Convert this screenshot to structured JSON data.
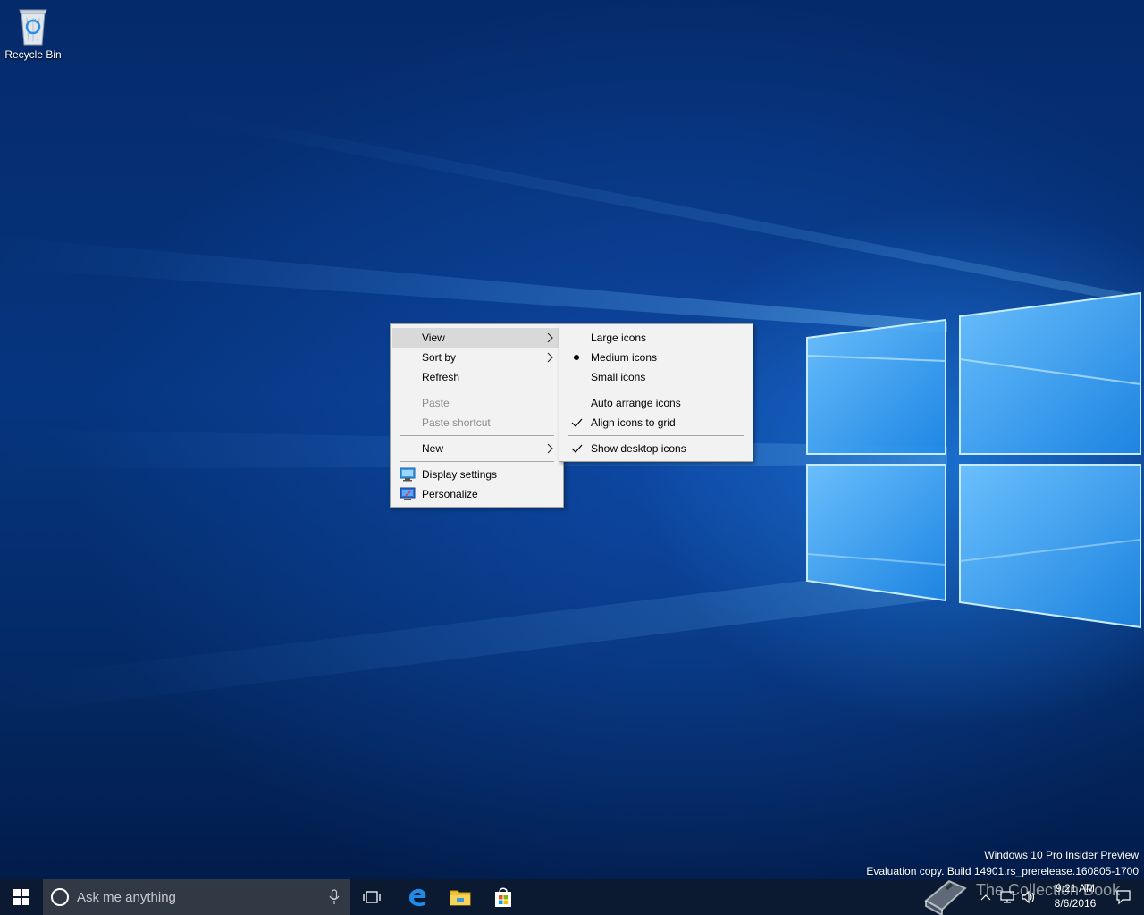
{
  "desktop": {
    "icons": [
      {
        "label": "Recycle Bin",
        "icon": "recycle-bin-icon"
      }
    ]
  },
  "context_menu": {
    "items": [
      {
        "label": "View",
        "has_submenu": true,
        "highlighted": true
      },
      {
        "label": "Sort by",
        "has_submenu": true
      },
      {
        "label": "Refresh"
      },
      {
        "label": "Paste",
        "disabled": true
      },
      {
        "label": "Paste shortcut",
        "disabled": true
      },
      {
        "label": "New",
        "has_submenu": true
      },
      {
        "label": "Display settings",
        "icon": "display-settings-icon"
      },
      {
        "label": "Personalize",
        "icon": "personalize-icon"
      }
    ]
  },
  "view_submenu": {
    "items": [
      {
        "label": "Large icons"
      },
      {
        "label": "Medium icons",
        "selected": true,
        "mark": "bullet"
      },
      {
        "label": "Small icons"
      },
      {
        "label": "Auto arrange icons"
      },
      {
        "label": "Align icons to grid",
        "checked": true,
        "mark": "check"
      },
      {
        "label": "Show desktop icons",
        "checked": true,
        "mark": "check"
      }
    ]
  },
  "watermark": {
    "line1": "Windows 10 Pro Insider Preview",
    "line2": "Evaluation copy. Build 14901.rs_prerelease.160805-1700"
  },
  "taskbar": {
    "search_placeholder": "Ask me anything",
    "pinned": [
      "task-view-icon",
      "edge-icon",
      "file-explorer-icon",
      "store-icon"
    ],
    "clock": {
      "time": "9:21 AM",
      "date": "8/6/2016"
    }
  },
  "overlay_logo": {
    "text": "The Collection Book"
  },
  "colors": {
    "taskbar": "#0b1a30",
    "search_box": "#313945",
    "menu_bg": "#f2f2f2",
    "menu_highlight": "#d9d9d9",
    "accent_blue": "#0078d7"
  }
}
